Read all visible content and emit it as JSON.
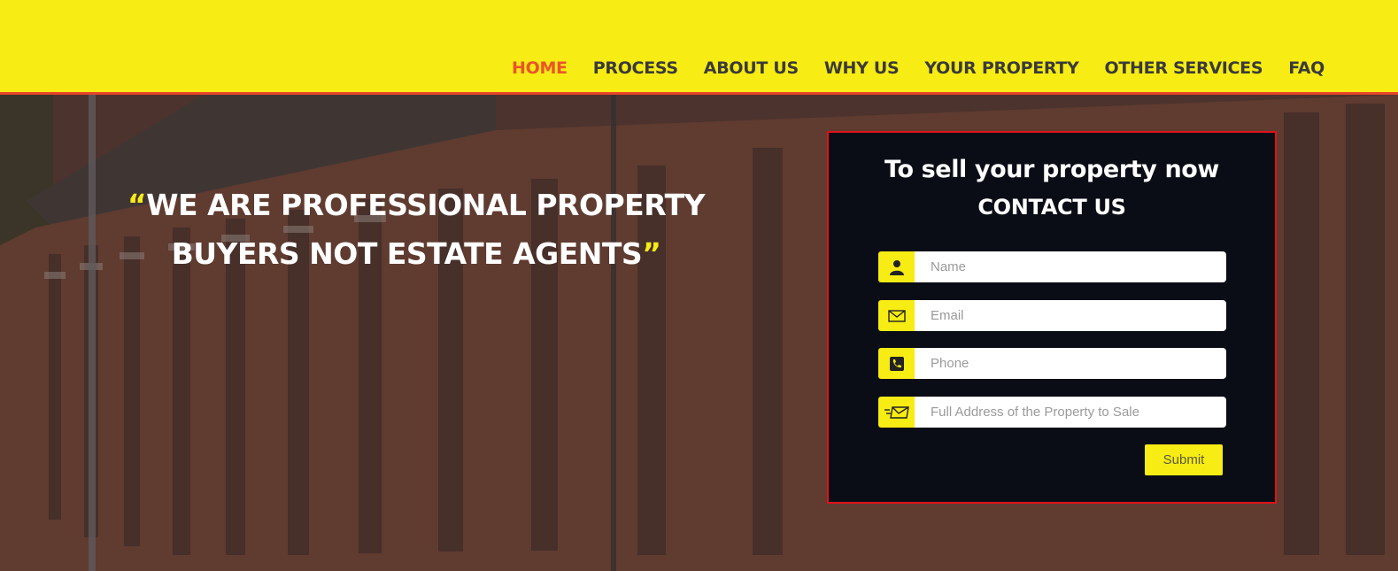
{
  "nav": {
    "items": [
      {
        "label": "HOME",
        "active": true
      },
      {
        "label": "PROCESS",
        "active": false
      },
      {
        "label": "ABOUT US",
        "active": false
      },
      {
        "label": "WHY US",
        "active": false
      },
      {
        "label": "YOUR PROPERTY",
        "active": false
      },
      {
        "label": "OTHER SERVICES",
        "active": false
      },
      {
        "label": "FAQ",
        "active": false
      }
    ]
  },
  "hero": {
    "open_quote": "“",
    "line1": "WE ARE PROFESSIONAL PROPERTY",
    "line2": "BUYERS NOT ESTATE AGENTS",
    "close_quote": "”"
  },
  "form": {
    "title": "To sell your property now",
    "subtitle": "CONTACT US",
    "fields": [
      {
        "icon": "user-icon",
        "placeholder": "Name",
        "value": ""
      },
      {
        "icon": "envelope-icon",
        "placeholder": "Email",
        "value": ""
      },
      {
        "icon": "phone-icon",
        "placeholder": "Phone",
        "value": ""
      },
      {
        "icon": "fast-mail-icon",
        "placeholder": "Full Address of the Property to Sale",
        "value": ""
      }
    ],
    "submit_label": "Submit"
  },
  "colors": {
    "header_bg": "#f7ec13",
    "accent": "#e8552a",
    "panel_bg": "#0a0d16",
    "panel_border": "#e0121b"
  }
}
